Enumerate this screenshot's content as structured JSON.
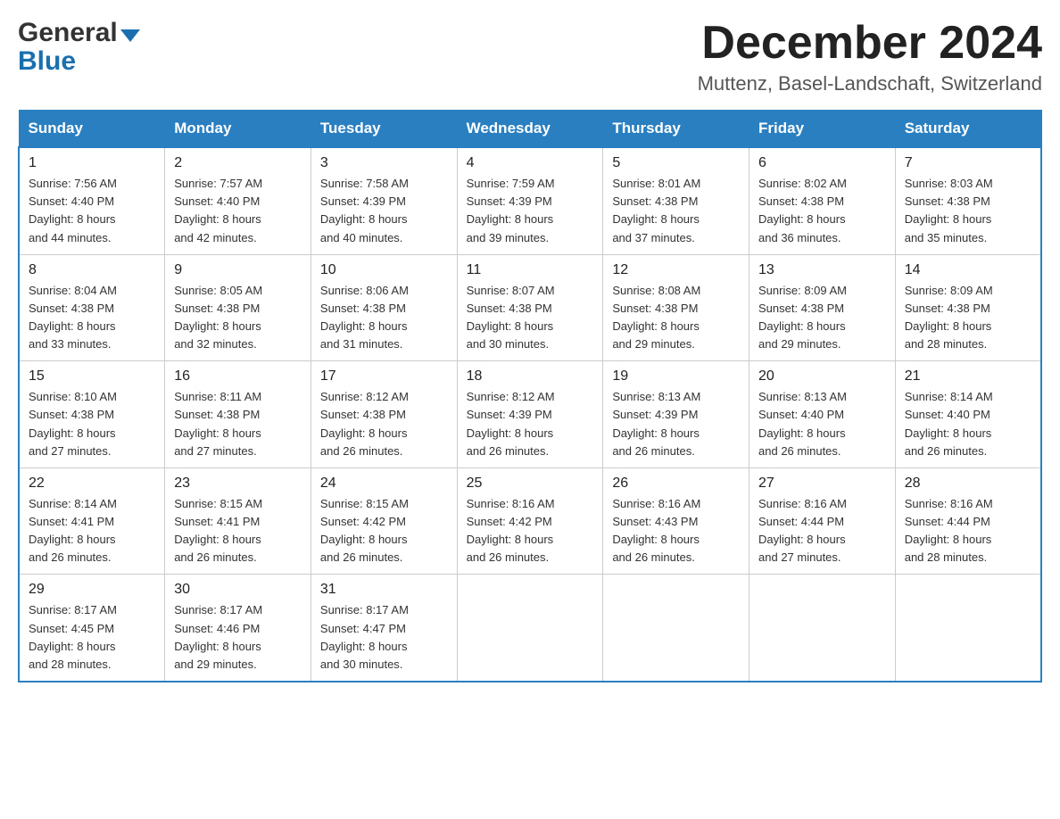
{
  "header": {
    "logo_general": "General",
    "logo_blue": "Blue",
    "month_title": "December 2024",
    "location": "Muttenz, Basel-Landschaft, Switzerland"
  },
  "days_of_week": [
    "Sunday",
    "Monday",
    "Tuesday",
    "Wednesday",
    "Thursday",
    "Friday",
    "Saturday"
  ],
  "weeks": [
    [
      {
        "day": "1",
        "sunrise": "7:56 AM",
        "sunset": "4:40 PM",
        "daylight": "8 hours and 44 minutes."
      },
      {
        "day": "2",
        "sunrise": "7:57 AM",
        "sunset": "4:40 PM",
        "daylight": "8 hours and 42 minutes."
      },
      {
        "day": "3",
        "sunrise": "7:58 AM",
        "sunset": "4:39 PM",
        "daylight": "8 hours and 40 minutes."
      },
      {
        "day": "4",
        "sunrise": "7:59 AM",
        "sunset": "4:39 PM",
        "daylight": "8 hours and 39 minutes."
      },
      {
        "day": "5",
        "sunrise": "8:01 AM",
        "sunset": "4:38 PM",
        "daylight": "8 hours and 37 minutes."
      },
      {
        "day": "6",
        "sunrise": "8:02 AM",
        "sunset": "4:38 PM",
        "daylight": "8 hours and 36 minutes."
      },
      {
        "day": "7",
        "sunrise": "8:03 AM",
        "sunset": "4:38 PM",
        "daylight": "8 hours and 35 minutes."
      }
    ],
    [
      {
        "day": "8",
        "sunrise": "8:04 AM",
        "sunset": "4:38 PM",
        "daylight": "8 hours and 33 minutes."
      },
      {
        "day": "9",
        "sunrise": "8:05 AM",
        "sunset": "4:38 PM",
        "daylight": "8 hours and 32 minutes."
      },
      {
        "day": "10",
        "sunrise": "8:06 AM",
        "sunset": "4:38 PM",
        "daylight": "8 hours and 31 minutes."
      },
      {
        "day": "11",
        "sunrise": "8:07 AM",
        "sunset": "4:38 PM",
        "daylight": "8 hours and 30 minutes."
      },
      {
        "day": "12",
        "sunrise": "8:08 AM",
        "sunset": "4:38 PM",
        "daylight": "8 hours and 29 minutes."
      },
      {
        "day": "13",
        "sunrise": "8:09 AM",
        "sunset": "4:38 PM",
        "daylight": "8 hours and 29 minutes."
      },
      {
        "day": "14",
        "sunrise": "8:09 AM",
        "sunset": "4:38 PM",
        "daylight": "8 hours and 28 minutes."
      }
    ],
    [
      {
        "day": "15",
        "sunrise": "8:10 AM",
        "sunset": "4:38 PM",
        "daylight": "8 hours and 27 minutes."
      },
      {
        "day": "16",
        "sunrise": "8:11 AM",
        "sunset": "4:38 PM",
        "daylight": "8 hours and 27 minutes."
      },
      {
        "day": "17",
        "sunrise": "8:12 AM",
        "sunset": "4:38 PM",
        "daylight": "8 hours and 26 minutes."
      },
      {
        "day": "18",
        "sunrise": "8:12 AM",
        "sunset": "4:39 PM",
        "daylight": "8 hours and 26 minutes."
      },
      {
        "day": "19",
        "sunrise": "8:13 AM",
        "sunset": "4:39 PM",
        "daylight": "8 hours and 26 minutes."
      },
      {
        "day": "20",
        "sunrise": "8:13 AM",
        "sunset": "4:40 PM",
        "daylight": "8 hours and 26 minutes."
      },
      {
        "day": "21",
        "sunrise": "8:14 AM",
        "sunset": "4:40 PM",
        "daylight": "8 hours and 26 minutes."
      }
    ],
    [
      {
        "day": "22",
        "sunrise": "8:14 AM",
        "sunset": "4:41 PM",
        "daylight": "8 hours and 26 minutes."
      },
      {
        "day": "23",
        "sunrise": "8:15 AM",
        "sunset": "4:41 PM",
        "daylight": "8 hours and 26 minutes."
      },
      {
        "day": "24",
        "sunrise": "8:15 AM",
        "sunset": "4:42 PM",
        "daylight": "8 hours and 26 minutes."
      },
      {
        "day": "25",
        "sunrise": "8:16 AM",
        "sunset": "4:42 PM",
        "daylight": "8 hours and 26 minutes."
      },
      {
        "day": "26",
        "sunrise": "8:16 AM",
        "sunset": "4:43 PM",
        "daylight": "8 hours and 26 minutes."
      },
      {
        "day": "27",
        "sunrise": "8:16 AM",
        "sunset": "4:44 PM",
        "daylight": "8 hours and 27 minutes."
      },
      {
        "day": "28",
        "sunrise": "8:16 AM",
        "sunset": "4:44 PM",
        "daylight": "8 hours and 28 minutes."
      }
    ],
    [
      {
        "day": "29",
        "sunrise": "8:17 AM",
        "sunset": "4:45 PM",
        "daylight": "8 hours and 28 minutes."
      },
      {
        "day": "30",
        "sunrise": "8:17 AM",
        "sunset": "4:46 PM",
        "daylight": "8 hours and 29 minutes."
      },
      {
        "day": "31",
        "sunrise": "8:17 AM",
        "sunset": "4:47 PM",
        "daylight": "8 hours and 30 minutes."
      },
      null,
      null,
      null,
      null
    ]
  ],
  "labels": {
    "sunrise": "Sunrise:",
    "sunset": "Sunset:",
    "daylight": "Daylight:"
  }
}
